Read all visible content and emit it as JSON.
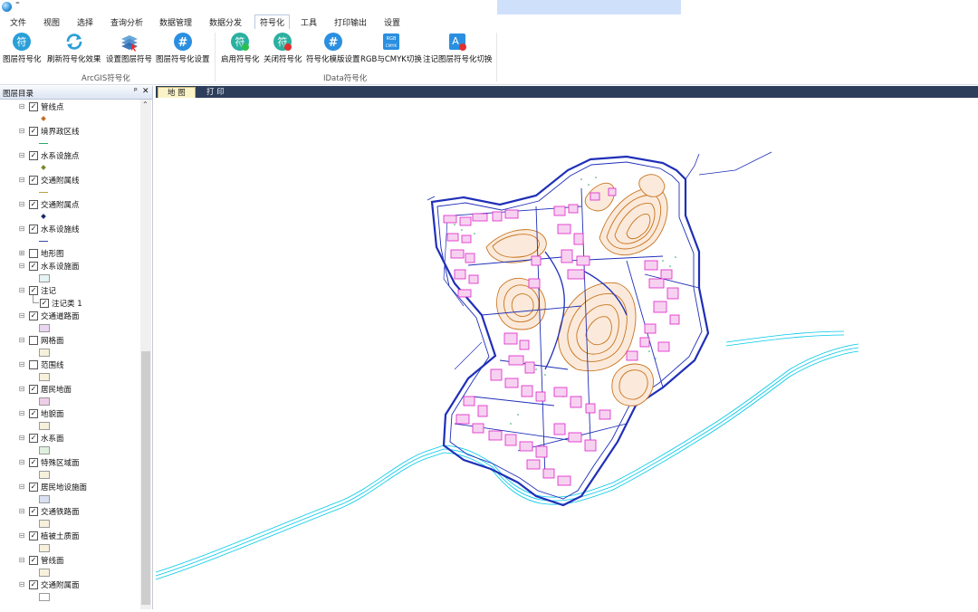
{
  "titlebar": {
    "quick_access": "⁼"
  },
  "menu": [
    "文件",
    "视图",
    "选择",
    "查询分析",
    "数据管理",
    "数据分发",
    "符号化",
    "工具",
    "打印输出",
    "设置"
  ],
  "menu_active": "符号化",
  "ribbon": {
    "groups": [
      {
        "label": "ArcGIS符号化",
        "buttons": [
          {
            "label": "图层符号化",
            "icon": "symbolize-layer-icon"
          },
          {
            "label": "刷新符号化效果",
            "icon": "refresh-icon"
          },
          {
            "label": "设置图层符号",
            "icon": "layer-symbol-icon"
          },
          {
            "label": "图层符号化设置",
            "icon": "hash-settings-icon"
          }
        ]
      },
      {
        "label": "IData符号化",
        "buttons": [
          {
            "label": "启用符号化",
            "icon": "enable-symbol-icon"
          },
          {
            "label": "关闭符号化",
            "icon": "disable-symbol-icon"
          },
          {
            "label": "符号化模版设置",
            "icon": "template-settings-icon"
          },
          {
            "label": "RGB与CMYK切换",
            "icon": "rgb-cmyk-icon"
          },
          {
            "label": "注记图层符号化切换",
            "icon": "annotation-switch-icon"
          }
        ]
      }
    ]
  },
  "toc": {
    "title": "图层目录",
    "pin": "ᵖ",
    "close": "✕",
    "layers": [
      {
        "name": "管线点",
        "checked": true,
        "symbol": {
          "kind": "point",
          "color": "#c0702a"
        }
      },
      {
        "name": "境界政区线",
        "checked": true,
        "symbol": {
          "kind": "line",
          "color": "#2ca86e"
        }
      },
      {
        "name": "水系设施点",
        "checked": true,
        "symbol": {
          "kind": "point",
          "color": "#7a8a2a"
        }
      },
      {
        "name": "交通附属线",
        "checked": true,
        "symbol": {
          "kind": "line",
          "color": "#b8a040"
        }
      },
      {
        "name": "交通附属点",
        "checked": true,
        "symbol": {
          "kind": "point",
          "color": "#1a2a6a"
        }
      },
      {
        "name": "水系设施线",
        "checked": true,
        "symbol": {
          "kind": "line",
          "color": "#3a4aa0"
        }
      },
      {
        "name": "地形图",
        "checked": false,
        "expand": "+",
        "symbol": null
      },
      {
        "name": "水系设施面",
        "checked": true,
        "symbol": {
          "kind": "fill",
          "color": "#e6f3f5"
        }
      },
      {
        "name": "注记",
        "checked": true,
        "symbol": null
      },
      {
        "name": "注记类 1",
        "checked": true,
        "child": true,
        "symbol": null
      },
      {
        "name": "交通道路面",
        "checked": true,
        "symbol": {
          "kind": "fill",
          "color": "#ead6f0"
        }
      },
      {
        "name": "网格面",
        "checked": false,
        "symbol": {
          "kind": "fill",
          "color": "#f7f1dc"
        }
      },
      {
        "name": "范围线",
        "checked": false,
        "symbol": {
          "kind": "fill",
          "color": "#f7f1dc"
        }
      },
      {
        "name": "居民地面",
        "checked": true,
        "symbol": {
          "kind": "fill",
          "color": "#efcde8"
        }
      },
      {
        "name": "地貌面",
        "checked": true,
        "symbol": {
          "kind": "fill",
          "color": "#f7f1dc"
        }
      },
      {
        "name": "水系面",
        "checked": true,
        "symbol": {
          "kind": "fill",
          "color": "#dff0df"
        }
      },
      {
        "name": "特殊区域面",
        "checked": true,
        "symbol": {
          "kind": "fill",
          "color": "#f7f1dc"
        }
      },
      {
        "name": "居民地设施面",
        "checked": true,
        "symbol": {
          "kind": "fill",
          "color": "#d9e0f2"
        }
      },
      {
        "name": "交通铁路面",
        "checked": true,
        "symbol": {
          "kind": "fill",
          "color": "#f7f1dc"
        }
      },
      {
        "name": "植被土质面",
        "checked": true,
        "symbol": {
          "kind": "fill",
          "color": "#f7f1dc"
        }
      },
      {
        "name": "管线面",
        "checked": true,
        "symbol": {
          "kind": "fill",
          "color": "#f7f1dc"
        }
      },
      {
        "name": "交通附属面",
        "checked": true,
        "symbol": {
          "kind": "fill",
          "color": "#ffffff"
        }
      }
    ]
  },
  "map_tabs": [
    {
      "label": "地 图",
      "active": true
    },
    {
      "label": "打 印",
      "active": false
    }
  ],
  "colors": {
    "tab_strip": "#2c3e5a",
    "active_tab": "#fbf3c7",
    "river": "#00c8e8",
    "road": "#1f2fb8",
    "building": "#e020c8",
    "contour": "#c8741e",
    "vegetation": "#2ca060"
  }
}
